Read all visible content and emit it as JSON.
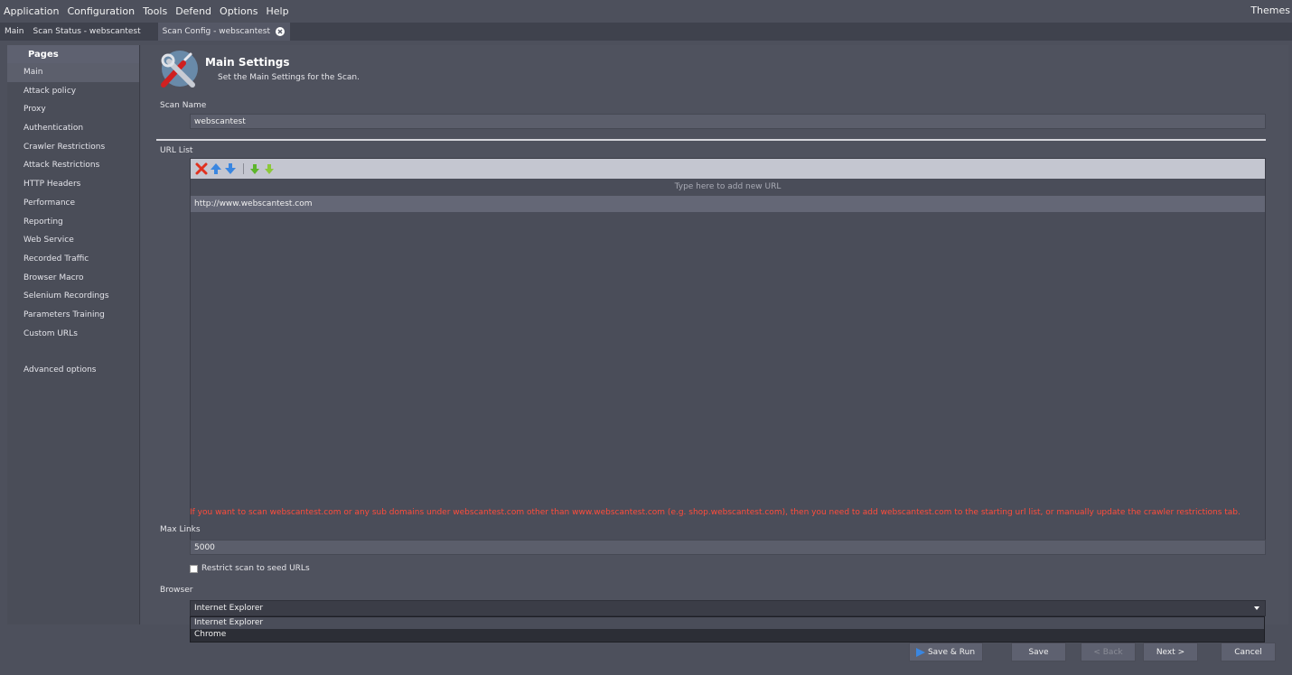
{
  "menubar": {
    "items": [
      "Application",
      "Configuration",
      "Tools",
      "Defend",
      "Options",
      "Help"
    ],
    "themes": "Themes"
  },
  "tabs": [
    {
      "label": "Main"
    },
    {
      "label": "Scan Status - webscantest"
    },
    {
      "label": "Scan Config - webscantest",
      "active": true
    }
  ],
  "sidebar": {
    "header": "Pages",
    "items": [
      "Main",
      "Attack policy",
      "Proxy",
      "Authentication",
      "Crawler Restrictions",
      "Attack Restrictions",
      "HTTP Headers",
      "Performance",
      "Reporting",
      "Web Service",
      "Recorded Traffic",
      "Browser Macro",
      "Selenium Recordings",
      "Parameters Training",
      "Custom URLs"
    ],
    "advanced": "Advanced options"
  },
  "header": {
    "title": "Main Settings",
    "subtitle": "Set the Main Settings for the Scan.",
    "icon": "wrench-screwdriver-icon"
  },
  "scan_name": {
    "label": "Scan Name",
    "value": "webscantest"
  },
  "url_list": {
    "label": "URL List",
    "toolbar_icons": [
      "delete-icon",
      "move-up-icon",
      "move-down-icon",
      "import-icon",
      "export-icon"
    ],
    "placeholder": "Type here to add new URL",
    "urls": [
      "http://www.webscantest.com"
    ]
  },
  "warning": "If you want to scan webscantest.com or any sub domains under webscantest.com other than www.webscantest.com (e.g. shop.webscantest.com), then you need to add webscantest.com to the starting url list, or manually update the crawler restrictions tab.",
  "max_links": {
    "label": "Max Links",
    "value": "5000"
  },
  "restrict_checkbox": {
    "label": "Restrict scan to seed URLs",
    "checked": false
  },
  "browser": {
    "label": "Browser",
    "selected": "Internet Explorer",
    "options": [
      "Internet Explorer",
      "Chrome"
    ]
  },
  "buttons": {
    "save_run": "Save & Run",
    "save": "Save",
    "back": "< Back",
    "next": "Next >",
    "cancel": "Cancel"
  },
  "colors": {
    "background": "#4d505c",
    "warning": "#ff4c3b",
    "toolbar": "#c4c6d0"
  }
}
